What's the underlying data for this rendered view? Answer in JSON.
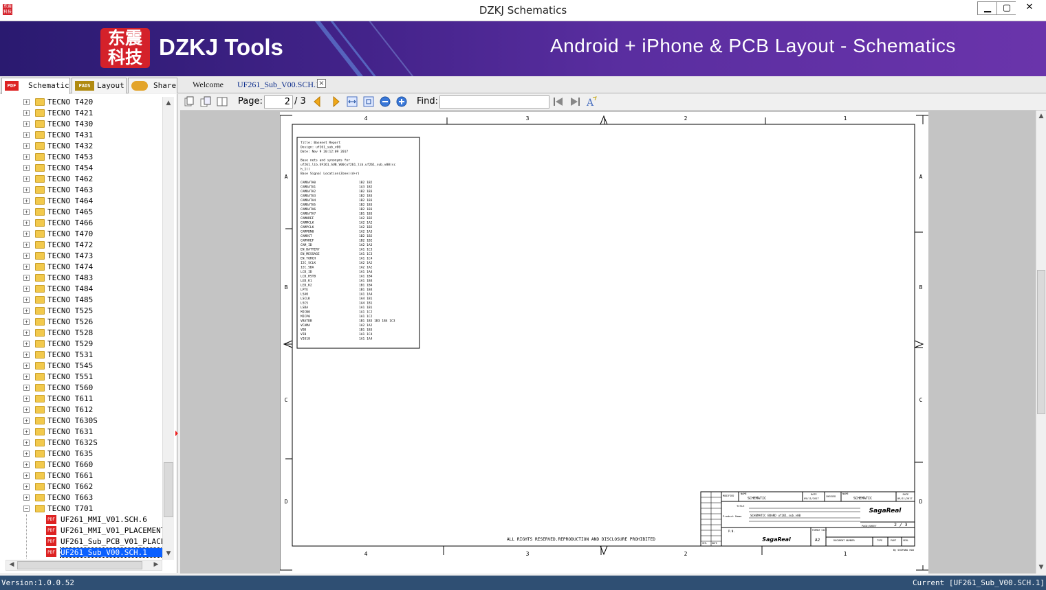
{
  "window": {
    "title": "DZKJ Schematics",
    "min": "▁",
    "max": "▢",
    "close": "✕"
  },
  "banner": {
    "logo_text": "东震\n科技",
    "brand": "DZKJ Tools",
    "tagline": "Android + iPhone & PCB Layout - Schematics"
  },
  "main_tabs": [
    {
      "label": "Schematic",
      "icon": "PDF"
    },
    {
      "label": "Layout",
      "icon": "PADS"
    },
    {
      "label": "Share",
      "icon": "cloud"
    }
  ],
  "doc_tabs": [
    {
      "label": "Welcome"
    },
    {
      "label": "UF261_Sub_V00.SCH.1"
    }
  ],
  "tree": {
    "folders": [
      "TECNO T420",
      "TECNO T421",
      "TECNO T430",
      "TECNO T431",
      "TECNO T432",
      "TECNO T453",
      "TECNO T454",
      "TECNO T462",
      "TECNO T463",
      "TECNO T464",
      "TECNO T465",
      "TECNO T466",
      "TECNO T470",
      "TECNO T472",
      "TECNO T473",
      "TECNO T474",
      "TECNO T483",
      "TECNO T484",
      "TECNO T485",
      "TECNO T525",
      "TECNO T526",
      "TECNO T528",
      "TECNO T529",
      "TECNO T531",
      "TECNO T545",
      "TECNO T551",
      "TECNO T560",
      "TECNO T611",
      "TECNO T612",
      "TECNO T630S",
      "TECNO T631",
      "TECNO T632S",
      "TECNO T635",
      "TECNO T660",
      "TECNO T661",
      "TECNO T662",
      "TECNO T663",
      "TECNO T701"
    ],
    "files": [
      "UF261_MMI_V01.SCH.6",
      "UF261_MMI_V01_PLACEMENT",
      "UF261_Sub_PCB_V01_PLACEMENT",
      "UF261_Sub_V00.SCH.1"
    ],
    "selected_index": 3
  },
  "toolbar": {
    "page_label": "Page:",
    "page_value": "2",
    "page_total": "/ 3",
    "find_label": "Find:",
    "find_value": ""
  },
  "sheet": {
    "cols_top": [
      "4",
      "3",
      "2",
      "1"
    ],
    "rows": [
      "A",
      "B",
      "C",
      "D"
    ],
    "report": {
      "title_line": "Title:      Basenet Report",
      "design_line": "Design:     uf261_sub_v00",
      "date_line": "Date:       Nov 9 20:12:09 2017",
      "intro1": "Base nets and synonyms for",
      "intro2": "uf261_lib.UF261_SUB_V00(uf261_lib.uf261_sub_v00(sc",
      "intro3": "h_1))",
      "header": "Base Signal              Location(Zone)(d+r)",
      "rows": [
        [
          "CAMDATA0",
          "1B2 1B2"
        ],
        [
          "CAMDATA1",
          "1A3 1B2"
        ],
        [
          "CAMDATA2",
          "1B2 1B3"
        ],
        [
          "CAMDATA3",
          "1B2 1B3"
        ],
        [
          "CAMDATA4",
          "1B2 1B3"
        ],
        [
          "CAMDATA5",
          "1B2 1B3"
        ],
        [
          "CAMDATA6",
          "1B2 1B3"
        ],
        [
          "CAMDATA7",
          "1B1 1B3"
        ],
        [
          "CAMHREF",
          "1A2 1B2"
        ],
        [
          "CAMMCLK",
          "1A2 1A2"
        ],
        [
          "CAMPCLK",
          "1A2 1B2"
        ],
        [
          "CAMPDN0",
          "1A2 1A3"
        ],
        [
          "CAMRST",
          "1B2 1B2"
        ],
        [
          "CAMVREF",
          "1B2 1B2"
        ],
        [
          "CAM_ID",
          "1A2 1A3"
        ],
        [
          "EN_BATTERY",
          "1A1 1C3"
        ],
        [
          "EN_MESSAGE",
          "1A1 1C3"
        ],
        [
          "EN_TORCH",
          "1A1 1C4"
        ],
        [
          "I2C_SCLK",
          "1A2 1A2"
        ],
        [
          "I2C_SDA",
          "1A2 1A2"
        ],
        [
          "LCD_ID",
          "1A1 1A4"
        ],
        [
          "LCD_RSTB",
          "1A1 1B4"
        ],
        [
          "LED_K1",
          "1A1 1B4"
        ],
        [
          "LED_K2",
          "1B1 1B4"
        ],
        [
          "LPTE",
          "1B1 1B4"
        ],
        [
          "LSA0",
          "1A1 1A4"
        ],
        [
          "LSCLK",
          "1A4 1B1"
        ],
        [
          "LSCS",
          "1A4 1B1"
        ],
        [
          "LSDA",
          "1A1 1B1"
        ],
        [
          "MICN0",
          "1A1 1C2"
        ],
        [
          "MICP0",
          "1A1 1C2"
        ],
        [
          "VBATDB",
          "1B1 1B3 1B3 1B4 1C3"
        ],
        [
          "VCAMA",
          "1A2 1A2"
        ],
        [
          "VDD",
          "1B1 1B3"
        ],
        [
          "VIB",
          "1A1 1C4"
        ],
        [
          "VIO18",
          "1A1 1A4"
        ]
      ]
    },
    "rights": "ALL RIGHTS RESERVED.REPRODUCTION AND DISCLOSURE PROHIBITED",
    "titleblock": {
      "modified": "MODIFIED",
      "name": "NAME",
      "schematic": "SCHEMATIC",
      "date": "DATE",
      "date_value": "09/11/2017",
      "checked": "CHECKED",
      "title": "TITLE",
      "product_name": "Product Name",
      "product_value": "SCHEMATIC BOARD uf261_sub_v00",
      "company": "SagaReal",
      "page_sheet": "PAGE/SHEET",
      "sheet_value": "2 / 3",
      "pn": "P.N.",
      "format_size": "FORMAT SIZE",
      "format_value": "A2",
      "doc_number": "DOCUMENT NUMBER",
      "type": "TYPE",
      "part": "PART",
      "verl": "VERL",
      "ver": "VER.",
      "date_short": "DATE",
      "by": "By SHIPANG HOU"
    }
  },
  "status": {
    "version": "Version:1.0.0.52",
    "current": "Current [UF261_Sub_V00.SCH.1]"
  },
  "colors": {
    "banner": "#43238a",
    "status": "#2f4f73",
    "selection": "#0a60ff",
    "logo": "#d4212a"
  }
}
